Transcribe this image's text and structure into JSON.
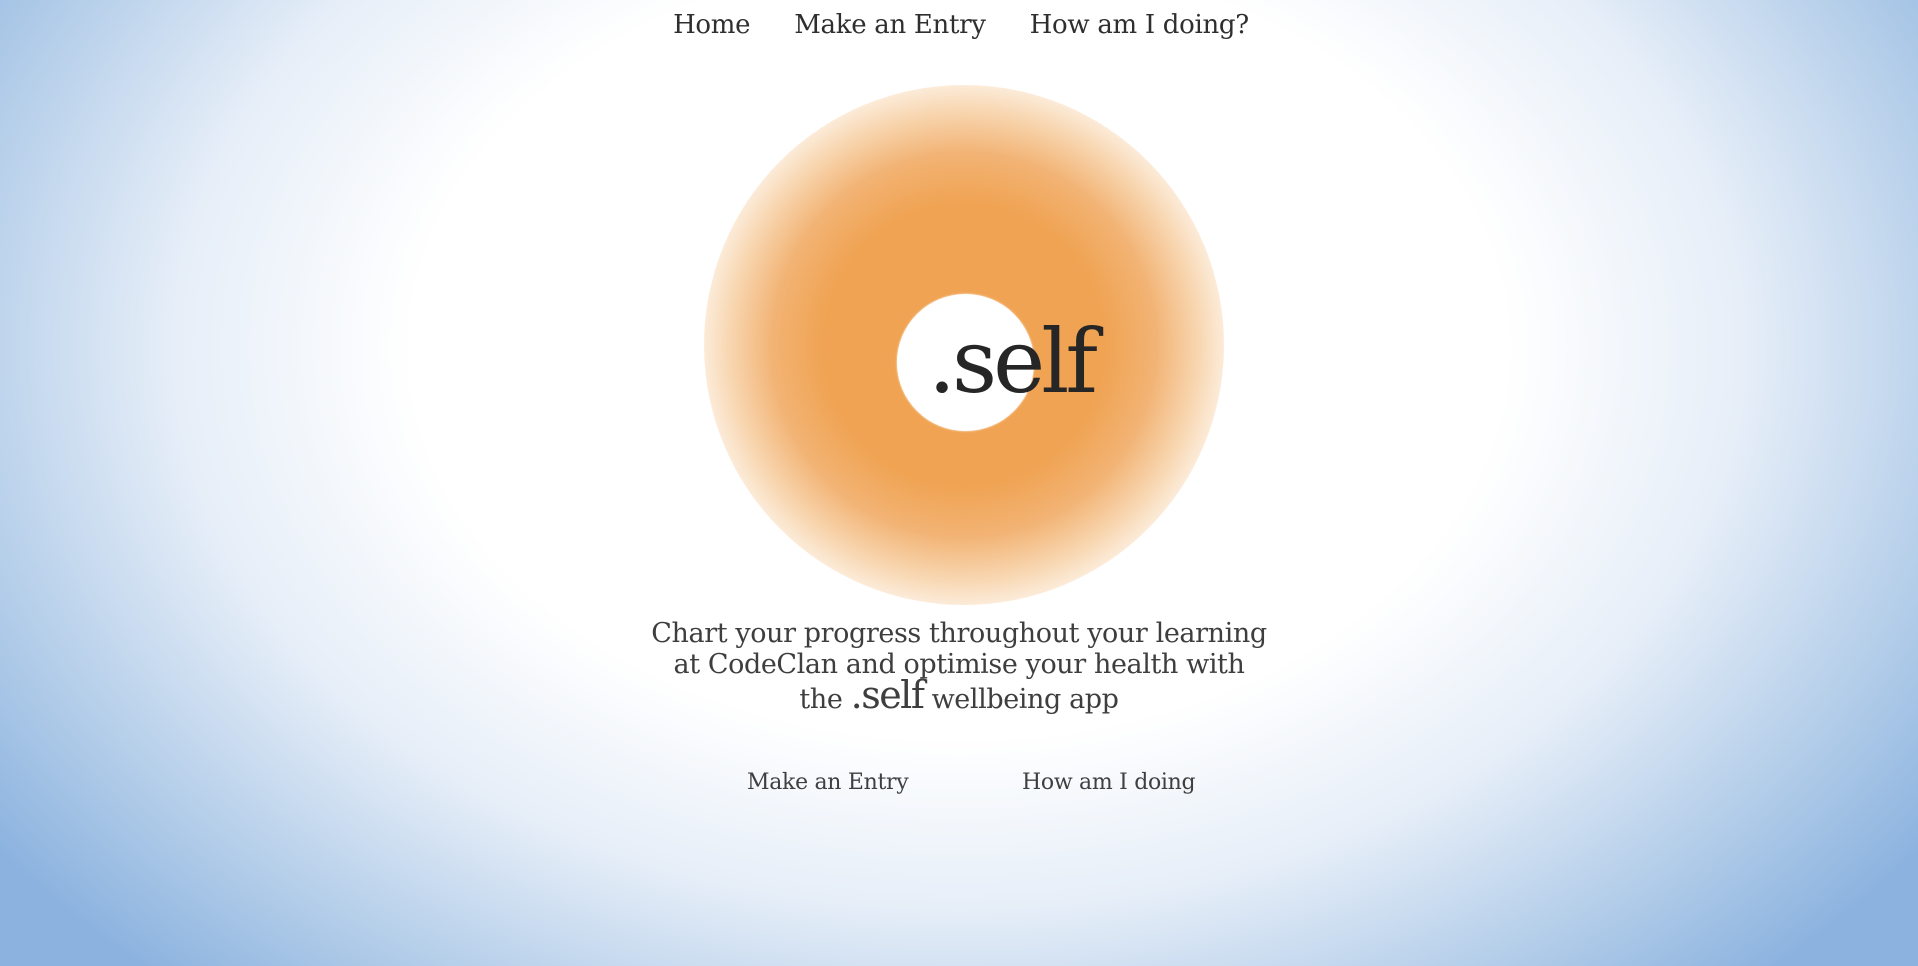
{
  "nav": {
    "home": "Home",
    "make_entry": "Make an Entry",
    "how_doing": "How am I doing?"
  },
  "hero": {
    "logo": ".self"
  },
  "tagline": {
    "line1": "Chart your progress throughout your learning",
    "line2": "at CodeClan and optimise your health with",
    "line3_pre": "the ",
    "line3_brand": ".self",
    "line3_post": " wellbeing app"
  },
  "actions": {
    "make_entry": "Make an Entry",
    "how_doing": "How am I doing"
  },
  "colors": {
    "glow": "#f0a352",
    "background_edge": "#8cb3df",
    "text": "#2b2b2b"
  }
}
